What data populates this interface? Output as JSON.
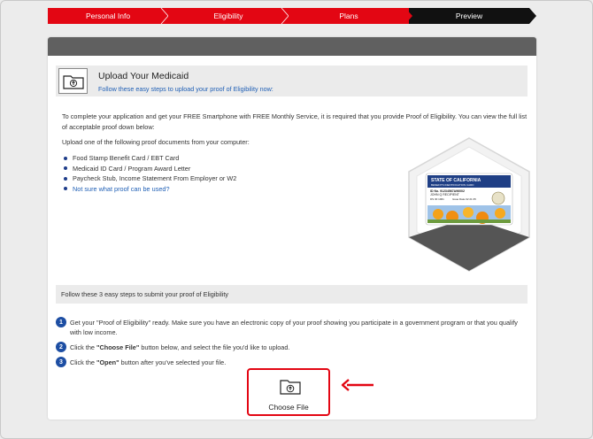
{
  "steps": [
    {
      "label": "Personal Info"
    },
    {
      "label": "Eligibility"
    },
    {
      "label": "Plans"
    },
    {
      "label": "Preview"
    }
  ],
  "upload": {
    "title": "Upload Your Medicaid",
    "subtitle": "Follow these easy steps to upload your proof of Eligibility now:"
  },
  "intro": "To complete your application and get your FREE Smartphone with FREE Monthly Service, it is required that you provide Proof of Eligibility. You can view the full list of acceptable proof down below:",
  "upload_one": "Upload one of the following proof documents from your computer:",
  "proofs": [
    "Food Stamp Benefit Card / EBT Card",
    "Medicaid ID Card / Program Award Letter",
    "Paycheck Stub, Income Statement From Employer or W2",
    "Not sure what proof can be used?"
  ],
  "card_image": {
    "line1": "STATE OF CALIFORNIA",
    "line2": "BENEFITS IDENTIFICATION CARD",
    "id": "ID No. 91234567A96002",
    "name": "JOHN Q RECIPIENT",
    "dob": "DS 30 1961",
    "issue": "Issue Date 02 21 05"
  },
  "steps_intro": "Follow these 3 easy steps to submit your proof of Eligibility",
  "instructions": [
    {
      "num": "1",
      "pre": "Get your \"Proof of Eligibility\" ready. Make sure you have an electronic copy of your proof showing you participate in a government program or that you qualify",
      "line2": "with low income."
    },
    {
      "num": "2",
      "pre": "Click the ",
      "bold": "\"Choose File\"",
      "post": " button below, and select the file you'd like to upload."
    },
    {
      "num": "3",
      "pre": "Click the ",
      "bold": "\"Open\"",
      "post": " button after you've selected your file."
    }
  ],
  "choose_file": "Choose File",
  "colors": {
    "brand_red": "#e30613",
    "step_black": "#111111",
    "link_blue": "#1f5fb5",
    "number_blue": "#1d4ea3"
  }
}
